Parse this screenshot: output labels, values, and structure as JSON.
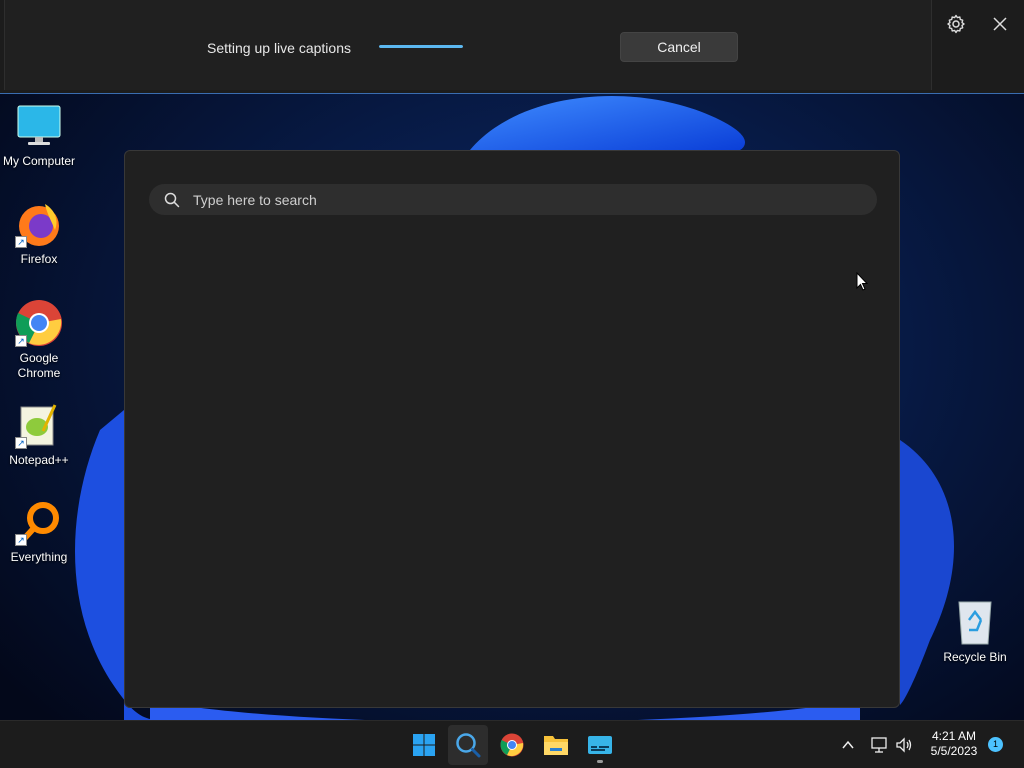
{
  "live_captions": {
    "status_text": "Setting up live captions",
    "progress": 1.0,
    "cancel_label": "Cancel",
    "settings_icon": "gear-icon",
    "close_icon": "close-icon"
  },
  "desktop_icons": [
    {
      "label": "My Computer",
      "icon": "monitor-icon"
    },
    {
      "label": "Firefox",
      "icon": "firefox-icon"
    },
    {
      "label": "Google Chrome",
      "icon": "chrome-icon"
    },
    {
      "label": "Notepad++",
      "icon": "notepad-plus-plus-icon"
    },
    {
      "label": "Everything",
      "icon": "everything-search-icon"
    }
  ],
  "recycle_bin": {
    "label": "Recycle Bin",
    "icon": "recycle-bin-icon"
  },
  "search_panel": {
    "placeholder": "Type here to search",
    "value": ""
  },
  "taskbar": {
    "items": [
      "start-icon",
      "search-icon",
      "chrome-icon",
      "file-explorer-icon",
      "live-captions-icon"
    ],
    "tray": {
      "time": "4:21 AM",
      "date": "5/5/2023",
      "notification_count": "1"
    }
  },
  "colors": {
    "accent": "#5cb8f0",
    "panel_bg": "#202020",
    "taskbar_bg": "#1c1c1c"
  }
}
